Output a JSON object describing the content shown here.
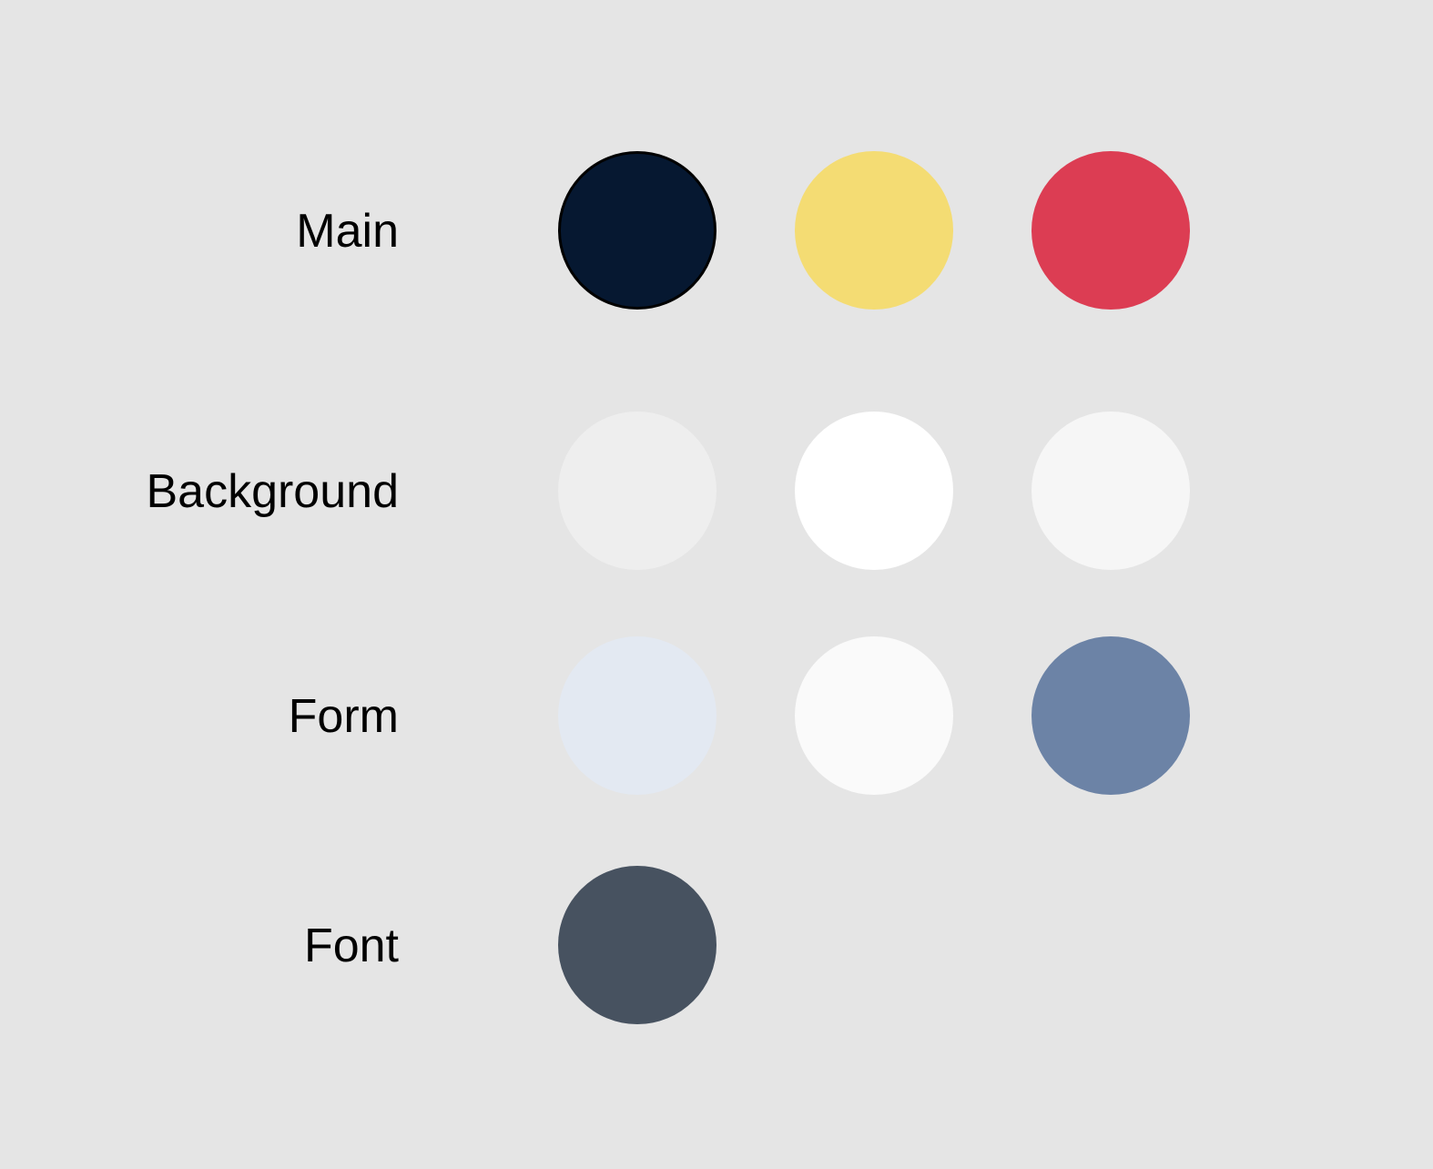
{
  "palette": {
    "groups": [
      {
        "label": "Main",
        "swatches": [
          {
            "color": "#061831",
            "outlined": true
          },
          {
            "color": "#f4dc73",
            "outlined": false
          },
          {
            "color": "#dc3d53",
            "outlined": false
          }
        ]
      },
      {
        "label": "Background",
        "swatches": [
          {
            "color": "#eeeeee",
            "outlined": false
          },
          {
            "color": "#ffffff",
            "outlined": false
          },
          {
            "color": "#f6f6f6",
            "outlined": false
          }
        ]
      },
      {
        "label": "Form",
        "swatches": [
          {
            "color": "#e3e9f2",
            "outlined": false
          },
          {
            "color": "#fafafa",
            "outlined": false
          },
          {
            "color": "#6c83a6",
            "outlined": false
          }
        ]
      },
      {
        "label": "Font",
        "swatches": [
          {
            "color": "#475260",
            "outlined": false
          }
        ]
      }
    ]
  }
}
